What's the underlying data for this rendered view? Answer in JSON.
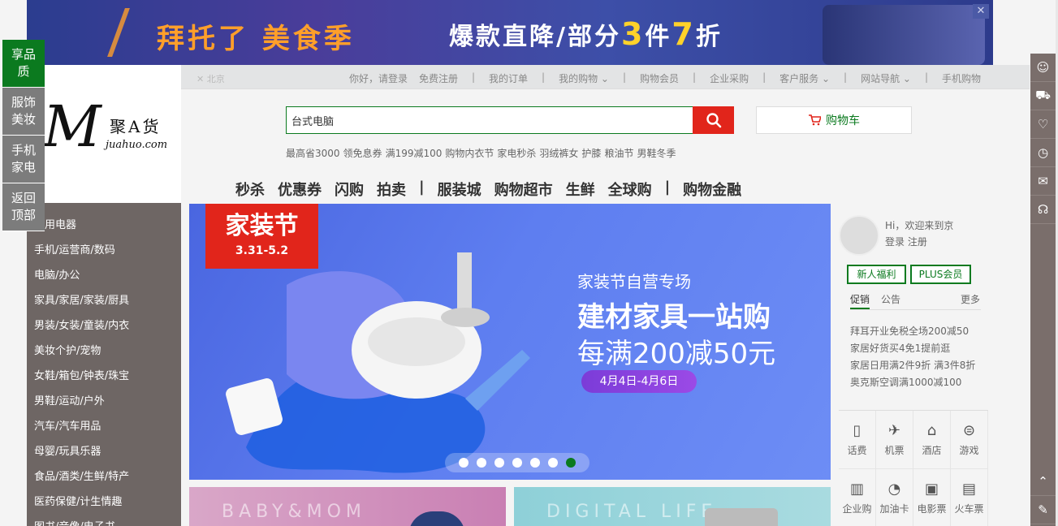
{
  "banner": {
    "left_text": "拜托了 美食季",
    "right_prefix": "爆款直降/部分",
    "right_n1": "3",
    "right_mid": "件",
    "right_n2": "7",
    "right_suffix": "折",
    "close": "✕"
  },
  "topbar": {
    "location": "✕ 北京",
    "links": [
      "你好，请登录",
      "免费注册",
      "|",
      "我的订单",
      "|",
      "我的购物 ⌄",
      "|",
      "购物会员",
      "|",
      "企业采购",
      "|",
      "客户服务 ⌄",
      "|",
      "网站导航 ⌄",
      "|",
      "手机购物"
    ]
  },
  "logo": {
    "mark": "M",
    "cn": "聚A货",
    "en": "juahuo.com"
  },
  "search": {
    "value": "台式电脑",
    "button_icon": "search-icon"
  },
  "cart": {
    "label": "购物车"
  },
  "hotwords": [
    "最高省3000",
    "领免息券",
    "满199减100",
    "购物内衣节",
    "家电秒杀",
    "羽绒裤女",
    "护膝",
    "粮油节",
    "男鞋冬季"
  ],
  "nav": [
    "秒杀",
    "优惠券",
    "闪购",
    "拍卖",
    "|",
    "服装城",
    "购物超市",
    "生鲜",
    "全球购",
    "|",
    "购物金融"
  ],
  "categories": [
    "家用电器",
    "手机/运营商/数码",
    "电脑/办公",
    "家具/家居/家装/厨具",
    "男装/女装/童装/内衣",
    "美妆个护/宠物",
    "女鞋/箱包/钟表/珠宝",
    "男鞋/运动/户外",
    "汽车/汽车用品",
    "母婴/玩具乐器",
    "食品/酒类/生鲜/特产",
    "医药保健/计生情趣",
    "图书/音像/电子书"
  ],
  "left_float": [
    "享品质",
    "服饰美妆",
    "手机家电",
    "返回顶部"
  ],
  "carousel": {
    "badge_title": "家装节",
    "badge_date": "3.31-5.2",
    "subtitle": "家装节自营专场",
    "headline": "建材家具一站购",
    "offer": "每满200减50元",
    "date_pill": "4月4日-4月6日",
    "dot_count": 7,
    "active_dot": 6
  },
  "user": {
    "greeting": "Hi，欢迎来到京",
    "login": "登录",
    "register": "注册",
    "btn_new": "新人福利",
    "btn_plus": "PLUS会员"
  },
  "news": {
    "tab_promo": "促销",
    "tab_notice": "公告",
    "more": "更多",
    "items": [
      "拜耳开业免税全场200减50",
      "家居好货买4免1提前逛",
      "家居日用满2件9折 满3件8折",
      "奥克斯空调满1000减100"
    ]
  },
  "services": [
    {
      "label": "话费",
      "icon": "phone-bill-icon"
    },
    {
      "label": "机票",
      "icon": "plane-icon"
    },
    {
      "label": "酒店",
      "icon": "hotel-icon"
    },
    {
      "label": "游戏",
      "icon": "gamepad-icon"
    },
    {
      "label": "企业购",
      "icon": "building-icon"
    },
    {
      "label": "加油卡",
      "icon": "fuel-icon"
    },
    {
      "label": "电影票",
      "icon": "camera-icon"
    },
    {
      "label": "火车票",
      "icon": "train-icon"
    }
  ],
  "bottom_banners": {
    "left": "BABY&MOM",
    "right": "DIGITAL LIFE"
  },
  "rail_icons": [
    "user-icon",
    "cart-icon",
    "heart-icon",
    "history-icon",
    "message-icon",
    "headset-icon"
  ],
  "rail_bottom": [
    "chevron-up-icon",
    "edit-icon"
  ],
  "colors": {
    "accent": "#0b7a1f",
    "red": "#e1251b",
    "category_bg": "#6e6664"
  }
}
